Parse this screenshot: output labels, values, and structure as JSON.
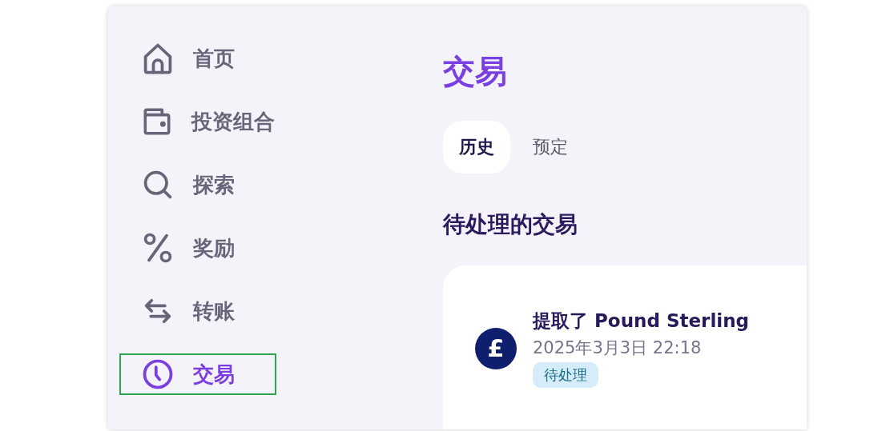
{
  "sidebar": {
    "items": [
      {
        "label": "首页",
        "kind": "home",
        "selected": false,
        "highlighted": false
      },
      {
        "label": "投资组合",
        "kind": "wallet",
        "selected": false,
        "highlighted": false
      },
      {
        "label": "探索",
        "kind": "search",
        "selected": false,
        "highlighted": false
      },
      {
        "label": "奖励",
        "kind": "percent",
        "selected": false,
        "highlighted": false
      },
      {
        "label": "转账",
        "kind": "transfer",
        "selected": false,
        "highlighted": false
      },
      {
        "label": "交易",
        "kind": "clock",
        "selected": true,
        "highlighted": true
      }
    ]
  },
  "main": {
    "title": "交易",
    "tabs": [
      {
        "label": "历史",
        "selected": true
      },
      {
        "label": "预定",
        "selected": false
      }
    ],
    "section_title": "待处理的交易",
    "transactions": [
      {
        "symbol": "£",
        "title": "提取了 Pound Sterling",
        "date": "2025年3月3日 22:18",
        "status": "待处理"
      }
    ]
  }
}
